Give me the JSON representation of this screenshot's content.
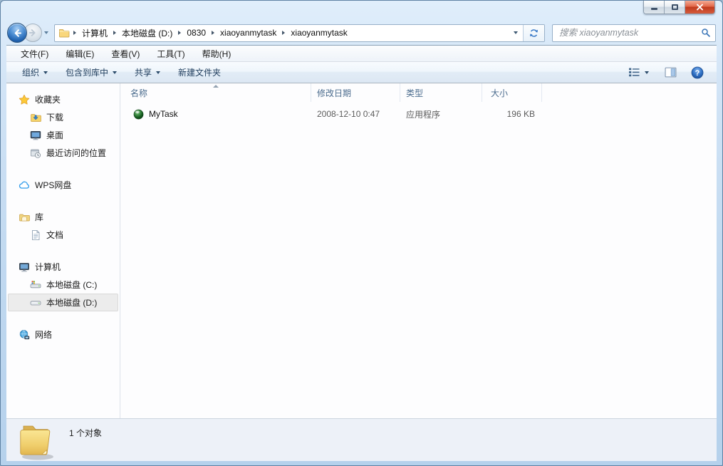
{
  "window": {
    "controls": [
      "minimize",
      "maximize",
      "close"
    ]
  },
  "navigation": {
    "breadcrumb": {
      "items": [
        "计算机",
        "本地磁盘 (D:)",
        "0830",
        "xiaoyanmytask",
        "xiaoyanmytask"
      ]
    },
    "search": {
      "placeholder": "搜索 xiaoyanmytask"
    }
  },
  "menubar": {
    "items": [
      "文件(F)",
      "编辑(E)",
      "查看(V)",
      "工具(T)",
      "帮助(H)"
    ]
  },
  "toolbar": {
    "buttons": [
      {
        "label": "组织",
        "has_dropdown": true
      },
      {
        "label": "包含到库中",
        "has_dropdown": true
      },
      {
        "label": "共享",
        "has_dropdown": true
      },
      {
        "label": "新建文件夹",
        "has_dropdown": false
      }
    ],
    "right_buttons": [
      {
        "icon": "views-icon",
        "has_dropdown": true
      },
      {
        "icon": "preview-pane-icon"
      },
      {
        "icon": "help-icon"
      }
    ],
    "help_glyph": "?"
  },
  "sidebar": {
    "groups": [
      {
        "label": "收藏夹",
        "icon": "star-icon",
        "children": [
          {
            "label": "下载",
            "icon": "downloads-icon"
          },
          {
            "label": "桌面",
            "icon": "desktop-icon"
          },
          {
            "label": "最近访问的位置",
            "icon": "recent-places-icon"
          }
        ]
      },
      {
        "label": "WPS网盘",
        "icon": "cloud-icon",
        "children": []
      },
      {
        "label": "库",
        "icon": "libraries-icon",
        "children": [
          {
            "label": "文档",
            "icon": "document-icon"
          }
        ]
      },
      {
        "label": "计算机",
        "icon": "computer-icon",
        "children": [
          {
            "label": "本地磁盘 (C:)",
            "icon": "drive-icon",
            "selected": false
          },
          {
            "label": "本地磁盘 (D:)",
            "icon": "drive-icon",
            "selected": true
          }
        ]
      },
      {
        "label": "网络",
        "icon": "network-icon",
        "children": []
      }
    ]
  },
  "file_list": {
    "columns": [
      "名称",
      "修改日期",
      "类型",
      "大小"
    ],
    "sort": {
      "column": "名称",
      "direction": "asc"
    },
    "rows": [
      {
        "name": "MyTask",
        "modified": "2008-12-10 0:47",
        "type": "应用程序",
        "size": "196 KB",
        "icon": "green-orb-app-icon"
      }
    ]
  },
  "status_bar": {
    "text": "1 个对象"
  },
  "colors": {
    "close_button_red": "#c13a1d",
    "glass_blue": "#c1d9f0",
    "toolbar_text": "#1e3c5c",
    "header_text": "#4a6b8d",
    "selection_gray": "#ececec",
    "app_icon_green": "#14561c"
  }
}
